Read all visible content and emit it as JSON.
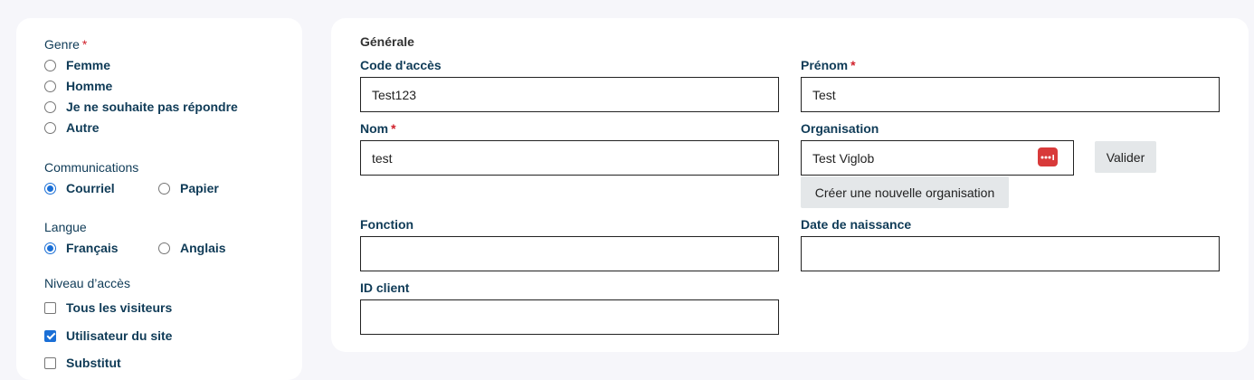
{
  "left": {
    "gender": {
      "title": "Genre",
      "required": "*",
      "options": [
        "Femme",
        "Homme",
        "Je ne souhaite pas répondre",
        "Autre"
      ]
    },
    "communications": {
      "title": "Communications",
      "options": [
        "Courriel",
        "Papier"
      ],
      "selected": "Courriel"
    },
    "language": {
      "title": "Langue",
      "options": [
        "Français",
        "Anglais"
      ],
      "selected": "Français"
    },
    "access": {
      "title": "Niveau d’accès",
      "options": [
        "Tous les visiteurs",
        "Utilisateur du site",
        "Substitut"
      ],
      "checked": [
        "Utilisateur du site"
      ]
    }
  },
  "main": {
    "section_title": "Générale",
    "fields": {
      "access_code": {
        "label": "Code d'accès",
        "value": "Test123"
      },
      "first_name": {
        "label": "Prénom",
        "required": "*",
        "value": "Test"
      },
      "last_name": {
        "label": "Nom",
        "required": "*",
        "value": "test"
      },
      "organisation": {
        "label": "Organisation",
        "value": "Test Viglob"
      },
      "function": {
        "label": "Fonction",
        "value": ""
      },
      "birth_date": {
        "label": "Date de naissance",
        "value": ""
      },
      "client_id": {
        "label": "ID client",
        "value": ""
      }
    },
    "buttons": {
      "validate": "Valider",
      "create_org": "Créer une nouvelle organisation"
    }
  },
  "colors": {
    "accent": "#1a6fd6",
    "label": "#0f3b57",
    "required": "#d0212b",
    "password_manager": "#d83a3a"
  },
  "icons": {
    "organisation_field": "password-manager-icon"
  }
}
